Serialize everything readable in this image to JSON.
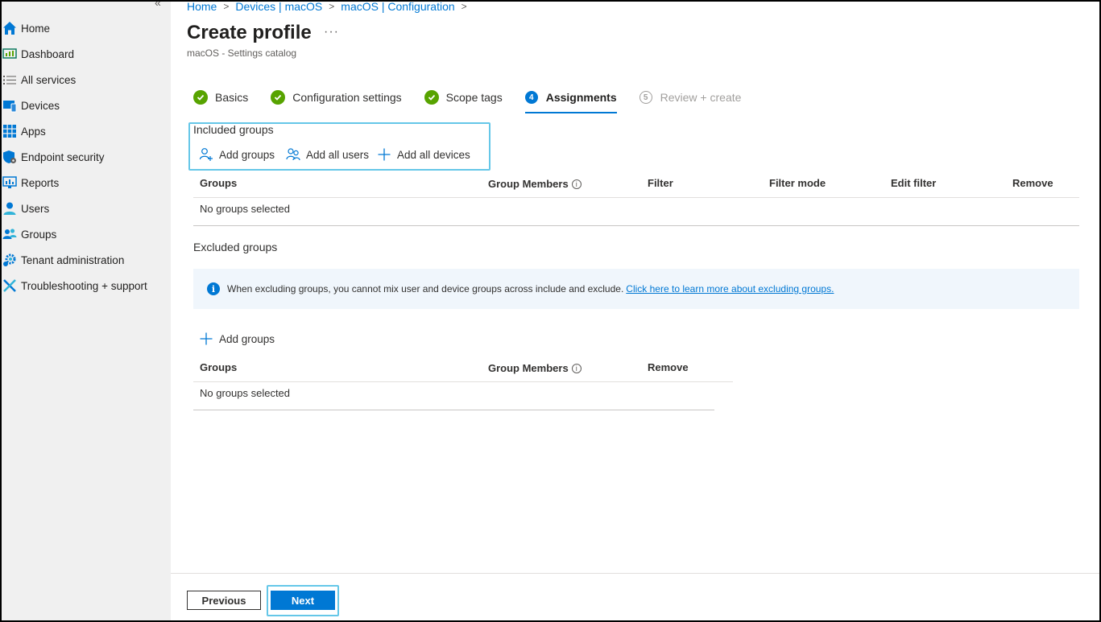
{
  "sidebar": {
    "collapse_glyph": "«",
    "items": [
      {
        "label": "Home",
        "icon": "home-icon"
      },
      {
        "label": "Dashboard",
        "icon": "dashboard-icon"
      },
      {
        "label": "All services",
        "icon": "list-icon"
      },
      {
        "label": "Devices",
        "icon": "devices-icon"
      },
      {
        "label": "Apps",
        "icon": "apps-grid-icon"
      },
      {
        "label": "Endpoint security",
        "icon": "shield-icon"
      },
      {
        "label": "Reports",
        "icon": "reports-icon"
      },
      {
        "label": "Users",
        "icon": "user-icon"
      },
      {
        "label": "Groups",
        "icon": "groups-icon"
      },
      {
        "label": "Tenant administration",
        "icon": "gear-icon"
      },
      {
        "label": "Troubleshooting + support",
        "icon": "tools-icon"
      }
    ]
  },
  "breadcrumb": [
    "Home",
    "Devices | macOS",
    "macOS | Configuration"
  ],
  "page": {
    "title": "Create profile",
    "more": "···",
    "subtitle": "macOS - Settings catalog"
  },
  "wizard": {
    "steps": [
      {
        "label": "Basics",
        "state": "done"
      },
      {
        "label": "Configuration settings",
        "state": "done"
      },
      {
        "label": "Scope tags",
        "state": "done"
      },
      {
        "label": "Assignments",
        "state": "active",
        "number": "4"
      },
      {
        "label": "Review + create",
        "state": "disabled",
        "number": "5"
      }
    ]
  },
  "included": {
    "label": "Included groups",
    "commands": {
      "add_groups": "Add groups",
      "add_all_users": "Add all users",
      "add_all_devices": "Add all devices"
    },
    "columns": {
      "groups": "Groups",
      "group_members": "Group Members",
      "filter": "Filter",
      "filter_mode": "Filter mode",
      "edit_filter": "Edit filter",
      "remove": "Remove"
    },
    "empty": "No groups selected"
  },
  "excluded": {
    "label": "Excluded groups",
    "info_text": "When excluding groups, you cannot mix user and device groups across include and exclude.",
    "info_link": "Click here to learn more about excluding groups.",
    "commands": {
      "add_groups": "Add groups"
    },
    "columns": {
      "groups": "Groups",
      "group_members": "Group Members",
      "remove": "Remove"
    },
    "empty": "No groups selected"
  },
  "footer": {
    "previous": "Previous",
    "next": "Next"
  },
  "colors": {
    "accent": "#0078d4",
    "success": "#57a300",
    "highlight": "#65c7e8",
    "sidebar_bg": "#f0f0f0",
    "info_bg": "#f0f6fc"
  }
}
